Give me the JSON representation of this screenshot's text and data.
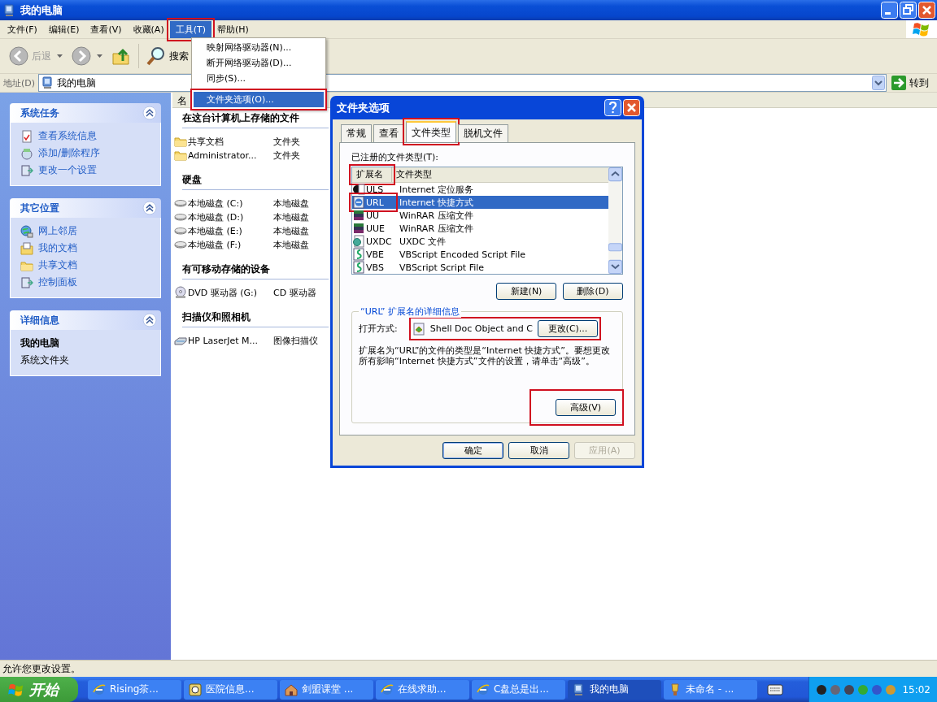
{
  "window": {
    "title": "我的电脑"
  },
  "menu_bar": [
    {
      "label": "文件(F)",
      "open": false,
      "highlighted": false
    },
    {
      "label": "编辑(E)",
      "open": false,
      "highlighted": false
    },
    {
      "label": "查看(V)",
      "open": false,
      "highlighted": false
    },
    {
      "label": "收藏(A)",
      "open": false,
      "highlighted": false
    },
    {
      "label": "工具(T)",
      "open": true,
      "highlighted": true
    },
    {
      "label": "帮助(H)",
      "open": false,
      "highlighted": false
    }
  ],
  "tools_menu": [
    {
      "kind": "item",
      "label": "映射网络驱动器(N)...",
      "selected": false,
      "highlighted": false
    },
    {
      "kind": "item",
      "label": "断开网络驱动器(D)...",
      "selected": false,
      "highlighted": false
    },
    {
      "kind": "item",
      "label": "同步(S)...",
      "selected": false,
      "highlighted": false
    },
    {
      "kind": "separator"
    },
    {
      "kind": "item",
      "label": "文件夹选项(O)...",
      "selected": true,
      "highlighted": true
    }
  ],
  "toolbar": [
    {
      "kind": "back",
      "label": "后退",
      "disabled": true
    },
    {
      "kind": "forward"
    },
    {
      "kind": "up"
    },
    {
      "kind": "search",
      "label": "搜索",
      "disabled": false
    }
  ],
  "address_bar": {
    "label": "地址(D)",
    "value": "我的电脑",
    "go": "转到"
  },
  "task_panes": [
    {
      "kind": "links",
      "title": "系统任务",
      "expanded": true,
      "links": [
        {
          "kind": "info",
          "label": "查看系统信息"
        },
        {
          "kind": "programs",
          "label": "添加/删除程序"
        },
        {
          "kind": "settings",
          "label": "更改一个设置"
        }
      ]
    },
    {
      "kind": "links",
      "title": "其它位置",
      "expanded": true,
      "links": [
        {
          "kind": "network",
          "label": "网上邻居"
        },
        {
          "kind": "documents",
          "label": "我的文档"
        },
        {
          "kind": "folder",
          "label": "共享文档"
        },
        {
          "kind": "settings",
          "label": "控制面板"
        }
      ]
    },
    {
      "kind": "details",
      "title": "详细信息",
      "expanded": true,
      "name": "我的电脑",
      "description": "系统文件夹"
    }
  ],
  "file_list": {
    "columns": [
      "名"
    ],
    "groups": [
      {
        "title": "在这台计算机上存储的文件",
        "items": [
          {
            "kind": "folder",
            "name": "共享文档",
            "type": "文件夹"
          },
          {
            "kind": "folder",
            "name": "Administrator...",
            "type": "文件夹"
          }
        ]
      },
      {
        "title": "硬盘",
        "items": [
          {
            "kind": "drive",
            "name": "本地磁盘 (C:)",
            "type": "本地磁盘"
          },
          {
            "kind": "drive",
            "name": "本地磁盘 (D:)",
            "type": "本地磁盘"
          },
          {
            "kind": "drive",
            "name": "本地磁盘 (E:)",
            "type": "本地磁盘"
          },
          {
            "kind": "drive",
            "name": "本地磁盘 (F:)",
            "type": "本地磁盘"
          }
        ]
      },
      {
        "title": "有可移动存储的设备",
        "items": [
          {
            "kind": "dvd",
            "name": "DVD 驱动器 (G:)",
            "type": "CD 驱动器"
          }
        ]
      },
      {
        "title": "扫描仪和照相机",
        "items": [
          {
            "kind": "scanner",
            "name": "HP LaserJet M...",
            "type": "图像扫描仪"
          }
        ]
      }
    ]
  },
  "dialog": {
    "title": "文件夹选项",
    "tabs": [
      {
        "label": "常规",
        "selected": false,
        "highlighted": false
      },
      {
        "label": "查看",
        "selected": false,
        "highlighted": false
      },
      {
        "label": "文件类型",
        "selected": true,
        "highlighted": true
      },
      {
        "label": "脱机文件",
        "selected": false,
        "highlighted": false
      }
    ],
    "list_label": "已注册的文件类型(T):",
    "columns": [
      {
        "label": "扩展名",
        "highlighted": true
      },
      {
        "label": "文件类型",
        "highlighted": false
      }
    ],
    "rows": [
      {
        "kind": "uls",
        "ext": "ULS",
        "type": "Internet 定位服务",
        "selected": false,
        "highlighted": false
      },
      {
        "kind": "url",
        "ext": "URL",
        "type": "Internet 快捷方式",
        "selected": true,
        "highlighted": true
      },
      {
        "kind": "rar",
        "ext": "UU",
        "type": "WinRAR 压缩文件",
        "selected": false,
        "highlighted": false
      },
      {
        "kind": "rar",
        "ext": "UUE",
        "type": "WinRAR 压缩文件",
        "selected": false,
        "highlighted": false
      },
      {
        "kind": "uxdc",
        "ext": "UXDC",
        "type": "UXDC 文件",
        "selected": false,
        "highlighted": false
      },
      {
        "kind": "script",
        "ext": "VBE",
        "type": "VBScript Encoded Script File",
        "selected": false,
        "highlighted": false
      },
      {
        "kind": "script",
        "ext": "VBS",
        "type": "VBScript Script File",
        "selected": false,
        "highlighted": false
      }
    ],
    "list_buttons": [
      {
        "label": "新建(N)",
        "disabled": false,
        "highlighted": false
      },
      {
        "label": "删除(D)",
        "disabled": false,
        "highlighted": false
      }
    ],
    "details": {
      "title": "“URL” 扩展名的详细信息",
      "open_with_label": "打开方式:",
      "program": "Shell Doc Object and C",
      "change_button": "更改(C)...",
      "open_with_highlighted": true,
      "description": "扩展名为“URL”的文件的类型是“Internet 快捷方式”。要想更改所有影响“Internet 快捷方式”文件的设置，请单击“高级”。",
      "advanced_button": "高级(V)",
      "advanced_highlighted": true
    },
    "buttons": [
      {
        "label": "确定",
        "disabled": false,
        "default": true
      },
      {
        "label": "取消",
        "disabled": false,
        "default": false
      },
      {
        "label": "应用(A)",
        "disabled": true,
        "default": false
      }
    ]
  },
  "status_bar": {
    "text": "允许您更改设置。"
  },
  "taskbar": {
    "start": "开始",
    "tasks": [
      {
        "kind": "ie",
        "label": "Rising茶...",
        "selected": false
      },
      {
        "kind": "app",
        "label": "医院信息...",
        "selected": false
      },
      {
        "kind": "home",
        "label": "剑盟课堂 ...",
        "selected": false
      },
      {
        "kind": "ie",
        "label": "在线求助...",
        "selected": false
      },
      {
        "kind": "ie",
        "label": "C盘总是出...",
        "selected": false
      },
      {
        "kind": "computer",
        "label": "我的电脑",
        "selected": true
      },
      {
        "kind": "paint",
        "label": "未命名 - ...",
        "selected": false
      }
    ],
    "clock": "15:02"
  }
}
